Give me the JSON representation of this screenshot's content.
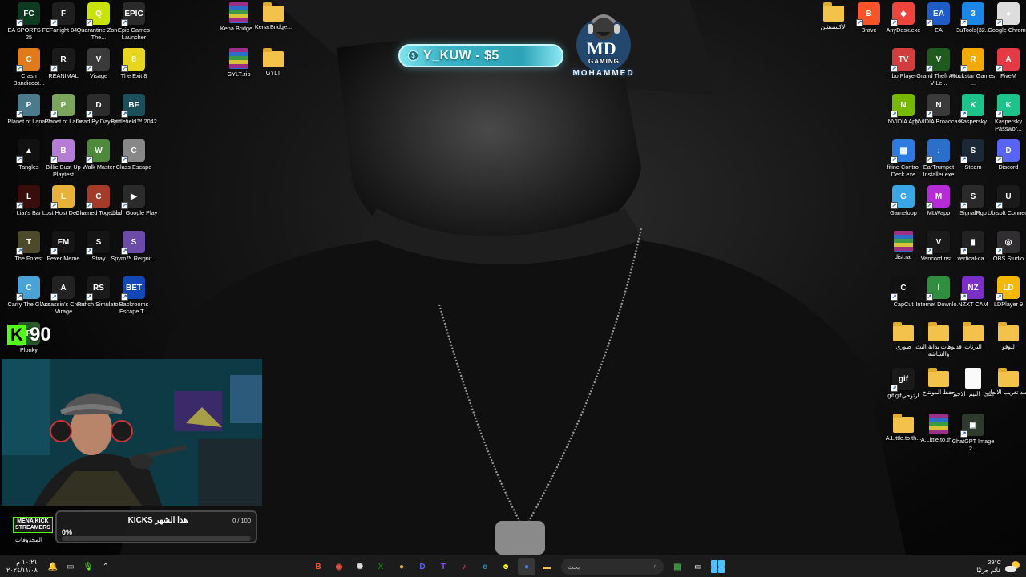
{
  "wallpaper": {
    "description_colors": {
      "bg": "#0a0a0a"
    }
  },
  "donation": {
    "text": "Y_KUW - $5",
    "coin": "$"
  },
  "logo": {
    "monogram": "MD",
    "tag": "GAMING",
    "name": "MOHAMMED"
  },
  "kick_badge": {
    "letter": "K",
    "count": "90"
  },
  "goal": {
    "title": "KICKS هذا الشهر",
    "count": "0 / 100",
    "percent": "0%",
    "progress": 0,
    "accent": "#53fc18"
  },
  "mena": {
    "line1": "MENA KICK",
    "line2": "STREAMERS"
  },
  "recycle_bin_label": "المحذوفات",
  "left_icons": [
    {
      "label": "EA SPORTS FC 25",
      "color": "#0d3b22",
      "glyph": "FC"
    },
    {
      "label": "Farlight 84",
      "color": "#1f1f1f",
      "glyph": "F"
    },
    {
      "label": "Quarantine Zone The...",
      "color": "#c9e20c",
      "glyph": "Q"
    },
    {
      "label": "Epic Games Launcher",
      "color": "#2a2a2a",
      "glyph": "EPIC"
    },
    {
      "label": "Crash Bandicoot...",
      "color": "#e07a1a",
      "glyph": "C"
    },
    {
      "label": "REANIMAL",
      "color": "#1a1a1a",
      "glyph": "R"
    },
    {
      "label": "Visage",
      "color": "#3a3a3a",
      "glyph": "V"
    },
    {
      "label": "The Exit 8",
      "color": "#e8d51e",
      "glyph": "8"
    },
    {
      "label": "Planet of Lana 2",
      "color": "#4b7a8c",
      "glyph": "P"
    },
    {
      "label": "Planet of Lana",
      "color": "#7aa55a",
      "glyph": "P"
    },
    {
      "label": "Dead By Daylight",
      "color": "#2c2c2c",
      "glyph": "D"
    },
    {
      "label": "Battlefield™ 2042",
      "color": "#1b4f5a",
      "glyph": "BF"
    },
    {
      "label": "Tangles",
      "color": "#111111",
      "glyph": "▲"
    },
    {
      "label": "Billie Bust Up Playtest",
      "color": "#b57bd6",
      "glyph": "B"
    },
    {
      "label": "Walk Master",
      "color": "#4e8a3a",
      "glyph": "W"
    },
    {
      "label": "Class Escape",
      "color": "#888888",
      "glyph": "C"
    },
    {
      "label": "Liar's Bar",
      "color": "#3a0d0d",
      "glyph": "L"
    },
    {
      "label": "Lost Host Demo",
      "color": "#e8b23a",
      "glyph": "L"
    },
    {
      "label": "Chained Together",
      "color": "#a33a2a",
      "glyph": "C"
    },
    {
      "label": "ألعاب Google Play",
      "color": "#2b2b2b",
      "glyph": "▶"
    },
    {
      "label": "The Forest",
      "color": "#4d4a2a",
      "glyph": "T"
    },
    {
      "label": "Fever Meme",
      "color": "#151515",
      "glyph": "FM"
    },
    {
      "label": "Stray",
      "color": "#151515",
      "glyph": "S"
    },
    {
      "label": "Spyro™ Reignit...",
      "color": "#6b4aa8",
      "glyph": "S"
    },
    {
      "label": "Carry The Glass",
      "color": "#4aa3d6",
      "glyph": "C"
    },
    {
      "label": "Assassin's Creed Mirage",
      "color": "#222222",
      "glyph": "A"
    },
    {
      "label": "Ranch Simulator",
      "color": "#1a1a1a",
      "glyph": "RS"
    },
    {
      "label": "Backrooms Escape T...",
      "color": "#1347b5",
      "glyph": "BET"
    },
    {
      "label": "Plonky",
      "color": "#2a5a2a",
      "glyph": "P"
    }
  ],
  "middle_icons": [
    {
      "label": "Kena.Bridge...",
      "type": "zip"
    },
    {
      "label": "Kena.Bridge...",
      "type": "folder"
    },
    {
      "label": "GYLT.zip",
      "type": "zip"
    },
    {
      "label": "GYLT",
      "type": "folder"
    }
  ],
  "right_icons": [
    {
      "label": "الاكستنشن",
      "type": "folder"
    },
    {
      "label": "Brave",
      "color": "#fb542b",
      "glyph": "B"
    },
    {
      "label": "AnyDesk.exe",
      "color": "#ef443b",
      "glyph": "◆"
    },
    {
      "label": "EA",
      "color": "#1e5cc8",
      "glyph": "EA"
    },
    {
      "label": "3uTools(32...",
      "color": "#1b85e8",
      "glyph": "3"
    },
    {
      "label": "Google Chrome",
      "color": "#dddddd",
      "glyph": "●"
    },
    {
      "label": "Ibo Player",
      "color": "#d43d3d",
      "glyph": "TV"
    },
    {
      "label": "Grand Theft Auto V Le...",
      "color": "#1f5a1f",
      "glyph": "V"
    },
    {
      "label": "Rockstar Games ...",
      "color": "#f2a900",
      "glyph": "R"
    },
    {
      "label": "FiveM",
      "color": "#e63946",
      "glyph": "A"
    },
    {
      "label": "NVIDIA App",
      "color": "#76b900",
      "glyph": "N"
    },
    {
      "label": "NVIDIA Broadcast",
      "color": "#3a3a3a",
      "glyph": "N"
    },
    {
      "label": "Kaspersky",
      "color": "#1ec38b",
      "glyph": "K"
    },
    {
      "label": "Kaspersky Passwor...",
      "color": "#1ec38b",
      "glyph": "K"
    },
    {
      "label": "fifine Control Deck.exe",
      "color": "#2d7be0",
      "glyph": "▦"
    },
    {
      "label": "EarTrumpet Installer.exe",
      "color": "#2a6fc9",
      "glyph": "↓"
    },
    {
      "label": "Steam",
      "color": "#1b2838",
      "glyph": "S"
    },
    {
      "label": "Discord",
      "color": "#5865f2",
      "glyph": "D"
    },
    {
      "label": "Gameloop",
      "color": "#3aa6e6",
      "glyph": "G"
    },
    {
      "label": "MLWapp",
      "color": "#b52bd6",
      "glyph": "M"
    },
    {
      "label": "SignalRgb",
      "color": "#2a2a2a",
      "glyph": "S"
    },
    {
      "label": "Ubisoft Connect",
      "color": "#1a1a1a",
      "glyph": "U"
    },
    {
      "label": "dist.rar",
      "type": "zip"
    },
    {
      "label": "VencordInst...",
      "color": "#1a1a1a",
      "glyph": "V"
    },
    {
      "label": "vertical-ca...",
      "color": "#222222",
      "glyph": "▮"
    },
    {
      "label": "OBS Studio",
      "color": "#302e31",
      "glyph": "◎"
    },
    {
      "label": "CapCut",
      "color": "#111111",
      "glyph": "C"
    },
    {
      "label": "Internet Downlo...",
      "color": "#2f8f3f",
      "glyph": "I"
    },
    {
      "label": "NZXT CAM",
      "color": "#7b2fc9",
      "glyph": "NZ"
    },
    {
      "label": "LDPlayer 9",
      "color": "#f5b800",
      "glyph": "LD"
    },
    {
      "label": "صوري",
      "type": "folder"
    },
    {
      "label": "فديوهات بداية البث والشاشه",
      "type": "folder"
    },
    {
      "label": "البرنات",
      "type": "folder"
    },
    {
      "label": "للوقو",
      "type": "folder"
    },
    {
      "label": "gif.gifارتوحي",
      "color": "#1a1a1a",
      "glyph": "gif"
    },
    {
      "label": "حفظ المونتاج",
      "type": "folder"
    },
    {
      "label": "ملف_التيم_الاخير",
      "type": "doc"
    },
    {
      "label": "مجلد تغريب الالعاب",
      "type": "folder"
    },
    {
      "label": "A.Little.to.th...",
      "type": "folder"
    },
    {
      "label": "A.Little.to.th...",
      "type": "zip"
    },
    {
      "label": "ChatGPT Image 2...",
      "color": "#2f3a2f",
      "glyph": "▣"
    }
  ],
  "taskbar": {
    "time": "١٠:٢١ م",
    "date": "٢٠٢٤/١١/٠٨",
    "search_placeholder": "بحث",
    "weather_temp": "29°C",
    "weather_desc": "غائم جزئيًا",
    "apps": [
      {
        "name": "brave-app",
        "glyph": "B",
        "color": "#fb542b"
      },
      {
        "name": "record-app",
        "glyph": "◉",
        "color": "#e74c3c"
      },
      {
        "name": "chatgpt-app",
        "glyph": "✺",
        "color": "#dddddd"
      },
      {
        "name": "xbox-app",
        "glyph": "X",
        "color": "#107c10"
      },
      {
        "name": "gameloop-app",
        "glyph": "●",
        "color": "#f2b632"
      },
      {
        "name": "discord-app",
        "glyph": "D",
        "color": "#5865f2"
      },
      {
        "name": "twitch-app",
        "glyph": "T",
        "color": "#9146ff"
      },
      {
        "name": "itunes-app",
        "glyph": "♪",
        "color": "#fc3c44"
      },
      {
        "name": "edge-app",
        "glyph": "e",
        "color": "#1e90c9"
      },
      {
        "name": "snap-app",
        "glyph": "☻",
        "color": "#fffc00"
      },
      {
        "name": "chrome-app",
        "glyph": "●",
        "color": "#4285f4"
      },
      {
        "name": "explorer-app",
        "glyph": "▬",
        "color": "#f3c24a"
      },
      {
        "name": "widgets-app",
        "glyph": "▦",
        "color": "#3a9b3a"
      },
      {
        "name": "gallery-app",
        "glyph": "▭",
        "color": "#cccccc"
      }
    ]
  }
}
